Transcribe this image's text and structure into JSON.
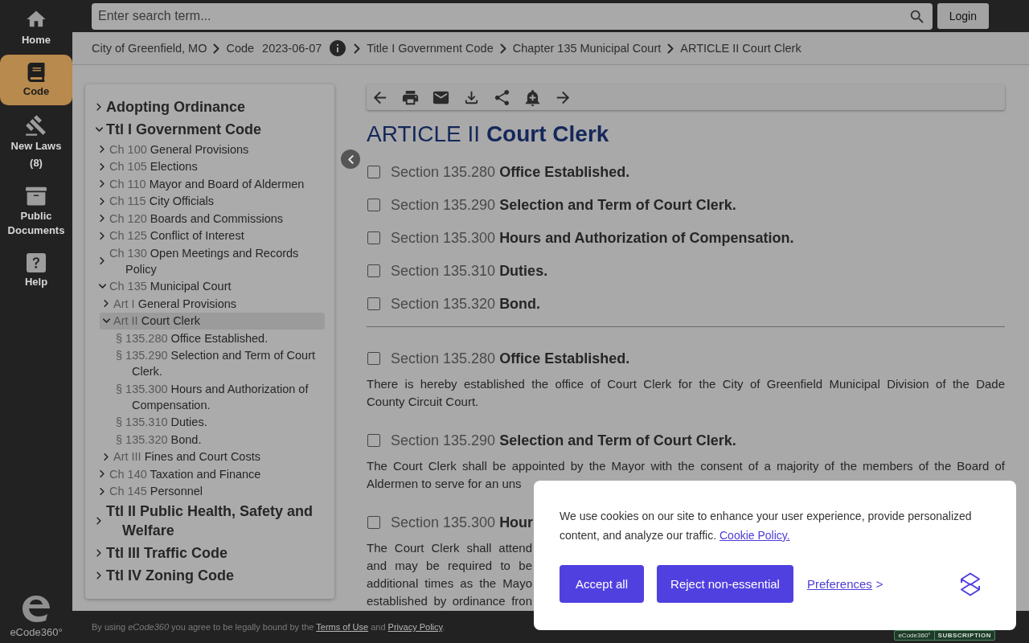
{
  "nav": {
    "items": [
      {
        "label": "Home",
        "selected": false
      },
      {
        "label": "Code",
        "selected": true
      },
      {
        "label": "New Laws",
        "count": "(8)",
        "selected": false
      },
      {
        "label": "Public Documents",
        "selected": false
      },
      {
        "label": "Help",
        "selected": false
      }
    ],
    "logo_text": "eCode360°"
  },
  "search": {
    "placeholder": "Enter search term..."
  },
  "login_button": "Login",
  "breadcrumb": [
    {
      "label": "City of Greenfield, MO"
    },
    {
      "label": "Code",
      "date": "2023-06-07"
    },
    {
      "label": "Title I Government Code"
    },
    {
      "label": "Chapter 135 Municipal Court"
    },
    {
      "label": "ARTICLE II Court Clerk"
    }
  ],
  "toc": [
    {
      "title": "Adopting Ordinance",
      "expanded": false,
      "selected": false
    },
    {
      "title": "Ttl I Government Code",
      "expanded": true,
      "selected": false,
      "children": [
        {
          "prefix": "Ch 100",
          "title": "General Provisions",
          "expanded": false,
          "selected": false
        },
        {
          "prefix": "Ch 105",
          "title": "Elections",
          "expanded": false,
          "selected": false
        },
        {
          "prefix": "Ch 110",
          "title": "Mayor and Board of Aldermen",
          "expanded": false,
          "selected": false
        },
        {
          "prefix": "Ch 115",
          "title": "City Officials",
          "expanded": false,
          "selected": false
        },
        {
          "prefix": "Ch 120",
          "title": "Boards and Commissions",
          "expanded": false,
          "selected": false
        },
        {
          "prefix": "Ch 125",
          "title": "Conflict of Interest",
          "expanded": false,
          "selected": false
        },
        {
          "prefix": "Ch 130",
          "title": "Open Meetings and Records Policy",
          "expanded": false,
          "selected": false
        },
        {
          "prefix": "Ch 135",
          "title": "Municipal Court",
          "expanded": true,
          "selected": false,
          "children": [
            {
              "prefix": "Art I",
              "title": "General Provisions",
              "expanded": false,
              "selected": false
            },
            {
              "prefix": "Art II",
              "title": "Court Clerk",
              "expanded": true,
              "selected": true,
              "children": [
                {
                  "prefix": "§ 135.280",
                  "title": "Office Established.",
                  "selected": false
                },
                {
                  "prefix": "§ 135.290",
                  "title": "Selection and Term of Court Clerk.",
                  "selected": false
                },
                {
                  "prefix": "§ 135.300",
                  "title": "Hours and Authorization of Compensation.",
                  "selected": false
                },
                {
                  "prefix": "§ 135.310",
                  "title": "Duties.",
                  "selected": false
                },
                {
                  "prefix": "§ 135.320",
                  "title": "Bond.",
                  "selected": false
                }
              ]
            },
            {
              "prefix": "Art III",
              "title": "Fines and Court Costs",
              "expanded": false,
              "selected": false
            }
          ]
        },
        {
          "prefix": "Ch 140",
          "title": "Taxation and Finance",
          "expanded": false,
          "selected": false
        },
        {
          "prefix": "Ch 145",
          "title": "Personnel",
          "expanded": false,
          "selected": false
        }
      ]
    },
    {
      "title": "Ttl II Public Health, Safety and Welfare",
      "expanded": false,
      "selected": false
    },
    {
      "title": "Ttl III Traffic Code",
      "expanded": false,
      "selected": false
    },
    {
      "title": "Ttl IV Zoning Code",
      "expanded": false,
      "selected": false
    }
  ],
  "article": {
    "number": "ARTICLE II",
    "title": "Court Clerk",
    "contents": [
      {
        "number": "Section 135.280",
        "title": "Office Established.",
        "checked": false
      },
      {
        "number": "Section 135.290",
        "title": "Selection and Term of Court Clerk.",
        "checked": false
      },
      {
        "number": "Section 135.300",
        "title": "Hours and Authorization of Compensation.",
        "checked": false
      },
      {
        "number": "Section 135.310",
        "title": "Duties.",
        "checked": false
      },
      {
        "number": "Section 135.320",
        "title": "Bond.",
        "checked": false
      }
    ],
    "sections": [
      {
        "number": "Section 135.280",
        "title": "Office Established.",
        "checked": false,
        "kind": "full",
        "lines": [
          "There is hereby established the office of Court Clerk for the City of Greenfield Municipal Division of the Dade",
          "County Circuit Court."
        ]
      },
      {
        "number": "Section 135.290",
        "title": "Selection and Term of Court Clerk.",
        "checked": false,
        "kind": "full",
        "lines": [
          "The Court Clerk shall be appointed by the Mayor with the consent of a majority of the members of the Board of",
          "Aldermen to serve for an uns"
        ]
      },
      {
        "number": "Section 135.300",
        "title": "Hour",
        "checked": false,
        "kind": "covered",
        "lines": [
          "The Court Clerk shall attend",
          "and may be required to be",
          "additional times as the Mayo",
          "established by ordinance fron"
        ]
      }
    ]
  },
  "cookie_banner": {
    "text": "We use cookies on our site to enhance your user experience, provide personalized content, and analyze our traffic.",
    "policy_link": "Cookie Policy.",
    "buttons": [
      "Accept all",
      "Reject non-essential"
    ],
    "preferences": {
      "label": "Preferences",
      "chevron": ">"
    }
  },
  "footer": {
    "notice": "By using *eCode360* you agree to be legally bound by the",
    "terms_link": "Terms of Use",
    "joiner": "and",
    "privacy_link": "Privacy Policy",
    "end": ".",
    "badge": {
      "brand": "eCode360°",
      "label": "SUBSCRIPTION"
    }
  }
}
